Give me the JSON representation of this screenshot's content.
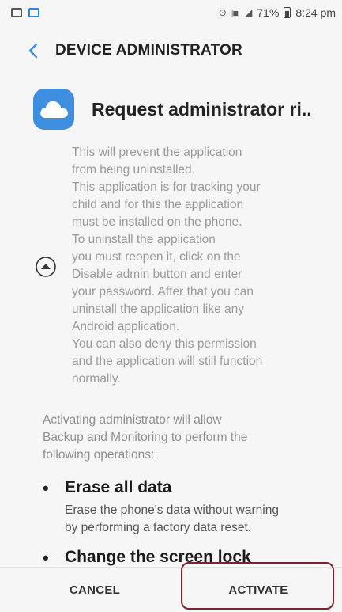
{
  "status_bar": {
    "battery": "71%",
    "time": "8:24 pm",
    "icons": [
      "gallery-icon",
      "app-icon",
      "alarm-icon",
      "nfc-icon",
      "signal-icon",
      "battery-icon"
    ]
  },
  "app_bar": {
    "title": "DEVICE ADMINISTRATOR",
    "back_icon": "chevron-left-icon"
  },
  "request": {
    "title": "Request administrator ri..",
    "icon": "cloud-icon",
    "description": "This will prevent the application\nfrom being uninstalled.\nThis application is for tracking your\nchild and for this the application\nmust be installed on the phone.\nTo uninstall the application\nyou must reopen it, click on the\nDisable admin button and enter\nyour password. After that you can\nuninstall the application like any\nAndroid application.\nYou can also deny this permission\nand the application will still function\nnormally."
  },
  "operations": {
    "intro": "Activating administrator will allow\nBackup and Monitoring to perform the\nfollowing operations:",
    "items": [
      {
        "title": "Erase all data",
        "description": "Erase the phone's data without warning\nby performing a factory data reset."
      },
      {
        "title": "Change the screen lock",
        "description": ""
      }
    ]
  },
  "actions": {
    "cancel_label": "CANCEL",
    "activate_label": "ACTIVATE"
  },
  "colors": {
    "accent": "#3f8fe0",
    "highlight": "#7a2430"
  }
}
